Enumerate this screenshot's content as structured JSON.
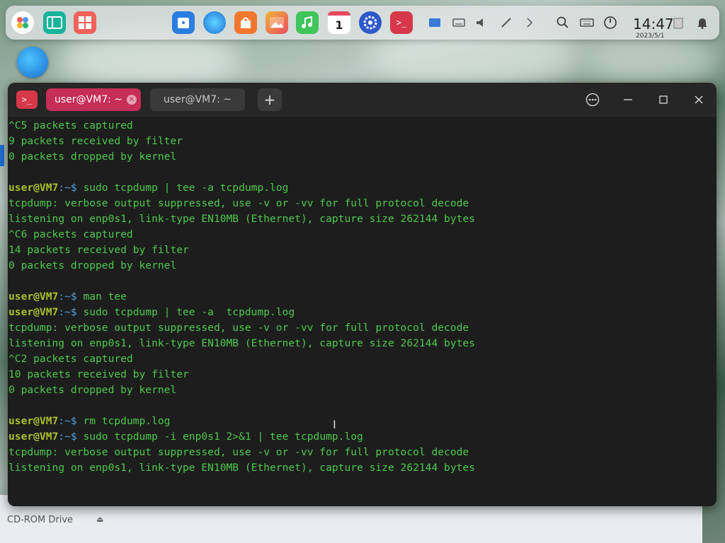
{
  "dock": {
    "apps": [
      {
        "name": "launcher-icon"
      },
      {
        "name": "multitask-view-icon"
      },
      {
        "name": "app-store-icon"
      },
      {
        "name": "file-manager-icon"
      },
      {
        "name": "browser-icon"
      },
      {
        "name": "app-store-bag-icon"
      },
      {
        "name": "image-viewer-icon"
      },
      {
        "name": "music-icon"
      },
      {
        "name": "calendar-icon"
      },
      {
        "name": "settings-icon"
      },
      {
        "name": "terminal-icon"
      }
    ],
    "calendar_day": "1",
    "tray": [
      "screenshot-icon",
      "keyboard-icon",
      "volume-icon",
      "pen-icon",
      "expand-icon",
      "search-icon",
      "keyboard-layout-icon",
      "power-icon"
    ],
    "clock": {
      "time": "14:47",
      "date": "2023/5/1"
    }
  },
  "background_window": {
    "drive_label": "CD-ROM Drive",
    "eject_glyph": "⏏"
  },
  "terminal": {
    "app_icon_glyph": ">_",
    "tabs": [
      {
        "label": "user@VM7: ~",
        "active": true
      },
      {
        "label": "user@VM7: ~",
        "active": false
      }
    ],
    "add_tab_glyph": "+",
    "lines": [
      {
        "type": "out",
        "text": "^C5 packets captured"
      },
      {
        "type": "out",
        "text": "9 packets received by filter"
      },
      {
        "type": "out",
        "text": "0 packets dropped by kernel"
      },
      {
        "type": "blank",
        "text": ""
      },
      {
        "type": "cmd",
        "user": "user@VM7",
        "sep": ":~$",
        "text": " sudo tcpdump | tee -a tcpdump.log"
      },
      {
        "type": "out",
        "text": "tcpdump: verbose output suppressed, use -v or -vv for full protocol decode"
      },
      {
        "type": "out",
        "text": "listening on enp0s1, link-type EN10MB (Ethernet), capture size 262144 bytes"
      },
      {
        "type": "out",
        "text": "^C6 packets captured"
      },
      {
        "type": "out",
        "text": "14 packets received by filter"
      },
      {
        "type": "out",
        "text": "0 packets dropped by kernel"
      },
      {
        "type": "blank",
        "text": ""
      },
      {
        "type": "cmd",
        "user": "user@VM7",
        "sep": ":~$",
        "text": " man tee"
      },
      {
        "type": "cmd",
        "user": "user@VM7",
        "sep": ":~$",
        "text": " sudo tcpdump | tee -a  tcpdump.log"
      },
      {
        "type": "out",
        "text": "tcpdump: verbose output suppressed, use -v or -vv for full protocol decode"
      },
      {
        "type": "out",
        "text": "listening on enp0s1, link-type EN10MB (Ethernet), capture size 262144 bytes"
      },
      {
        "type": "out",
        "text": "^C2 packets captured"
      },
      {
        "type": "out",
        "text": "10 packets received by filter"
      },
      {
        "type": "out",
        "text": "0 packets dropped by kernel"
      },
      {
        "type": "blank",
        "text": ""
      },
      {
        "type": "cmd",
        "user": "user@VM7",
        "sep": ":~$",
        "text": " rm tcpdump.log"
      },
      {
        "type": "cmd",
        "user": "user@VM7",
        "sep": ":~$",
        "text": " sudo tcpdump -i enp0s1 2>&1 | tee tcpdump.log"
      },
      {
        "type": "out",
        "text": "tcpdump: verbose output suppressed, use -v or -vv for full protocol decode"
      },
      {
        "type": "out",
        "text": "listening on enp0s1, link-type EN10MB (Ethernet), capture size 262144 bytes"
      }
    ]
  },
  "colors": {
    "output_text": "#4ec94e",
    "prompt_user": "#aabf2e",
    "prompt_path": "#4aa0e0",
    "active_tab": "#c62d57",
    "terminal_bg": "#1d1d1d"
  }
}
